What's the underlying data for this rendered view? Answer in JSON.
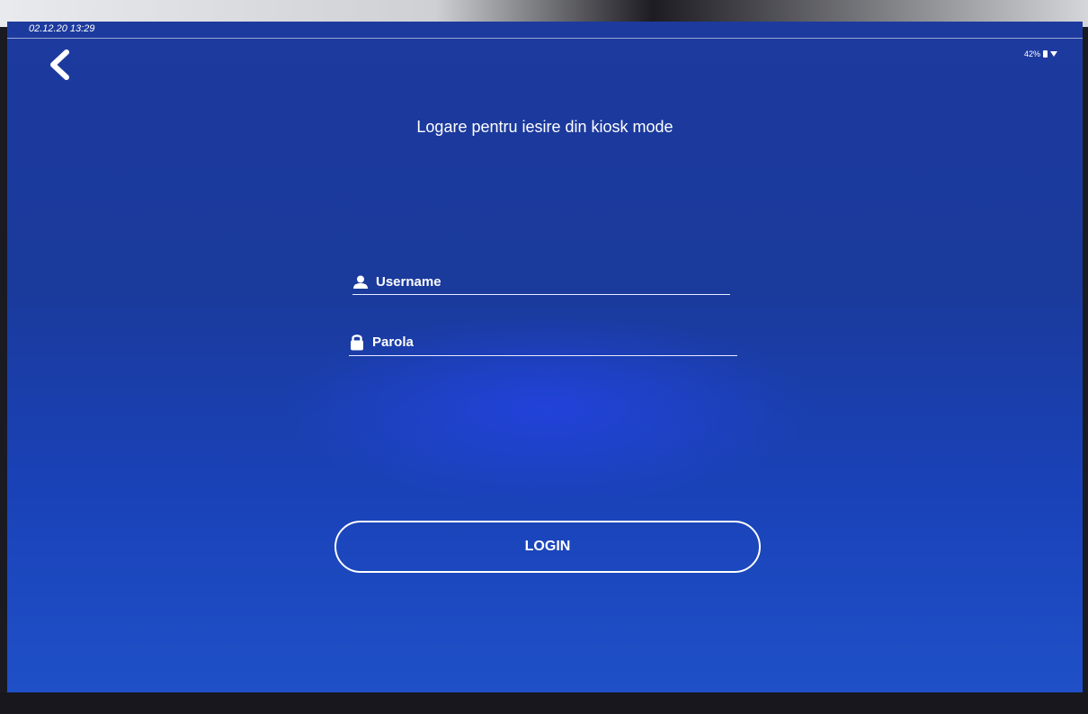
{
  "status_bar": {
    "datetime": "02.12.20 13:29",
    "battery": "42%"
  },
  "header": {
    "title": "Logare pentru iesire din kiosk mode"
  },
  "form": {
    "username_placeholder": "Username",
    "password_placeholder": "Parola",
    "login_label": "LOGIN"
  },
  "icons": {
    "back": "chevron-left-icon",
    "user": "user-icon",
    "lock": "lock-icon"
  },
  "colors": {
    "background": "#1a3a9c",
    "text": "#ffffff"
  }
}
